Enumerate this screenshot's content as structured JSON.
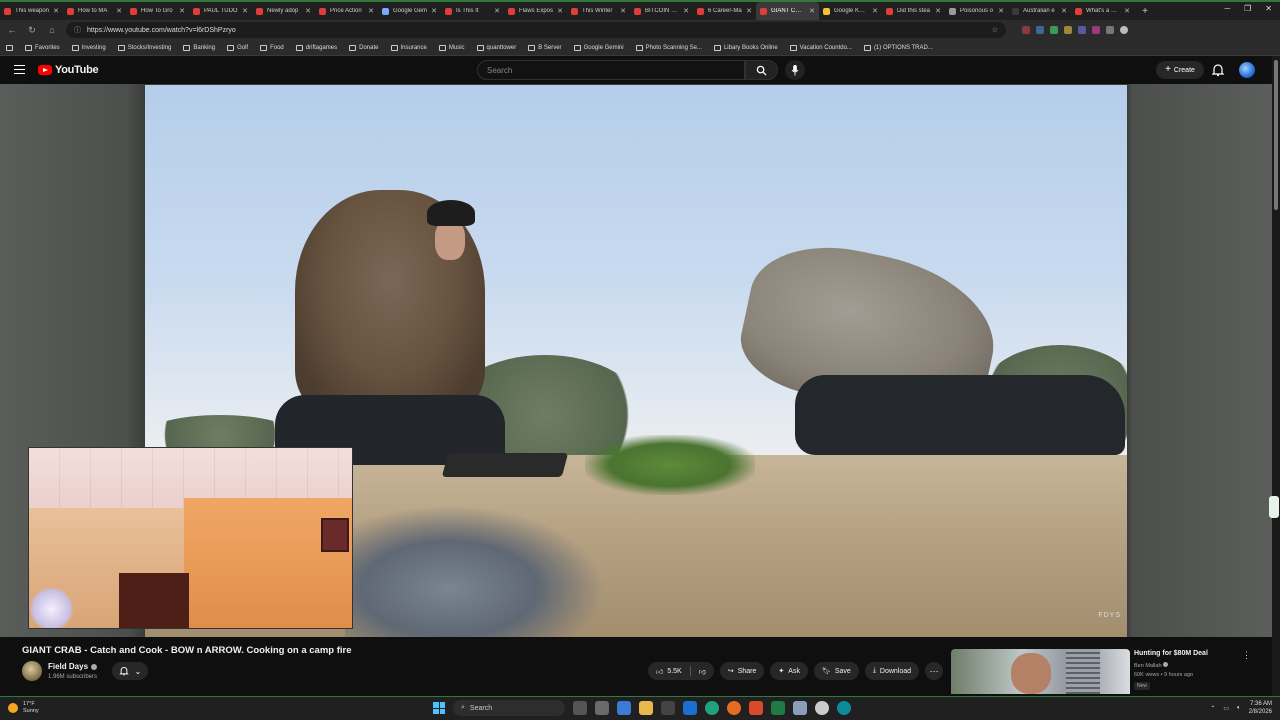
{
  "browser": {
    "tabs": [
      {
        "label": "This weapon",
        "color": "#e23b3b"
      },
      {
        "label": "How to MA",
        "color": "#e23b3b"
      },
      {
        "label": "How To Gro",
        "color": "#e23b3b"
      },
      {
        "label": "PAUL TUDO",
        "color": "#e23b3b"
      },
      {
        "label": "Newly adop",
        "color": "#e23b3b"
      },
      {
        "label": "Price Action",
        "color": "#e23b3b"
      },
      {
        "label": "Google Gem",
        "color": "#7aa7ff"
      },
      {
        "label": "Is This It",
        "color": "#e23b3b"
      },
      {
        "label": "Flaws Expos",
        "color": "#e23b3b"
      },
      {
        "label": "This Winter",
        "color": "#e23b3b"
      },
      {
        "label": "BITCOIN CR",
        "color": "#e23b3b"
      },
      {
        "label": "6 Career-Ma",
        "color": "#e23b3b"
      },
      {
        "label": "GIANT CRAB",
        "color": "#e23b3b"
      },
      {
        "label": "Google Keep",
        "color": "#f2c230"
      },
      {
        "label": "Did this stea",
        "color": "#e23b3b"
      },
      {
        "label": "Poisonous o",
        "color": "#9a9a9a"
      },
      {
        "label": "Australian e",
        "color": "#3a3a3a"
      },
      {
        "label": "What's a goo",
        "color": "#e23b3b"
      }
    ],
    "active_tab_index": 12,
    "url": "https://www.youtube.com/watch?v=l6rDShPzryo",
    "bookmarks": [
      "Favorites",
      "Investing",
      "Stocks/Investing",
      "Banking",
      "Golf",
      "Food",
      "driftagames",
      "Donate",
      "Insurance",
      "Music",
      "quanttower",
      "B Server",
      "Google Gemini",
      "Photo Scanning Se...",
      "Libary Books Online",
      "Vacation Countdo...",
      "(1) OPTIONS TRAD..."
    ]
  },
  "youtube": {
    "logo_text": "YouTube",
    "search_placeholder": "Search",
    "create_label": "Create"
  },
  "video": {
    "title": "GIANT CRAB - Catch and Cook - BOW n ARROW. Cooking on a camp fire",
    "watermark": "FDYS",
    "channel_name": "Field Days",
    "channel_subs": "1.96M subscribers",
    "likes": "5.5K",
    "share_label": "Share",
    "ask_label": "Ask",
    "save_label": "Save",
    "download_label": "Download"
  },
  "recommendation": {
    "title": "Hunting for $80M Deal",
    "channel": "Ben Mallah",
    "meta": "60K views • 9 hours ago",
    "badge": "New"
  },
  "taskbar": {
    "temp": "17°F",
    "weather": "Sunny",
    "search_label": "Search",
    "time": "7:36 AM",
    "date": "2/8/2026"
  }
}
